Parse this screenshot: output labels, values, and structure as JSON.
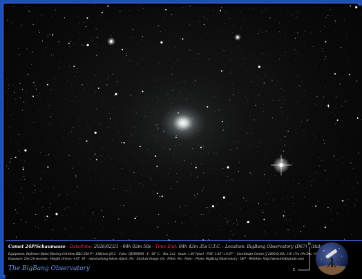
{
  "image": {
    "title": "Comet 24P/Schaumasse",
    "date_time_label": "- Date/time:",
    "date_time_value": "2026/02/21 - 04h 02m 59s -",
    "time_end_label": "Time End:",
    "time_end_value": "04h 42m 35s U.T.C. -",
    "location_label": "Location:",
    "location_value": "BigBang Observatory (D67) - (Italy)",
    "equipment_line": "Equipment: Reflector Baker Ritchey Chrétien RBC-250 F= 1382mm f/5.5 - Color: QHY600M - T: -10° C. - Bin: 2x2 - Scale: 1.81\"/pixel - FOV: 1.03° x 0.67° - Coordinate Centre (J 2000.0) RA: 11h 17m 19s Dec +06° 18' 19\"",
    "exposure_line": "Exposure: 20x120 seconds - Height Orizon: +33° 10' - Autotracking follow object: No - Stacked Image: On - Filter: No - Note: - Photo: BigBang Observatory - D67 - WebSite: http://www.bimbipirate.com",
    "observatory_name": "The BigBang Observatory",
    "compass": {
      "north": "N",
      "east": "E"
    },
    "logo_icon": "observatory-telescope-icon"
  }
}
